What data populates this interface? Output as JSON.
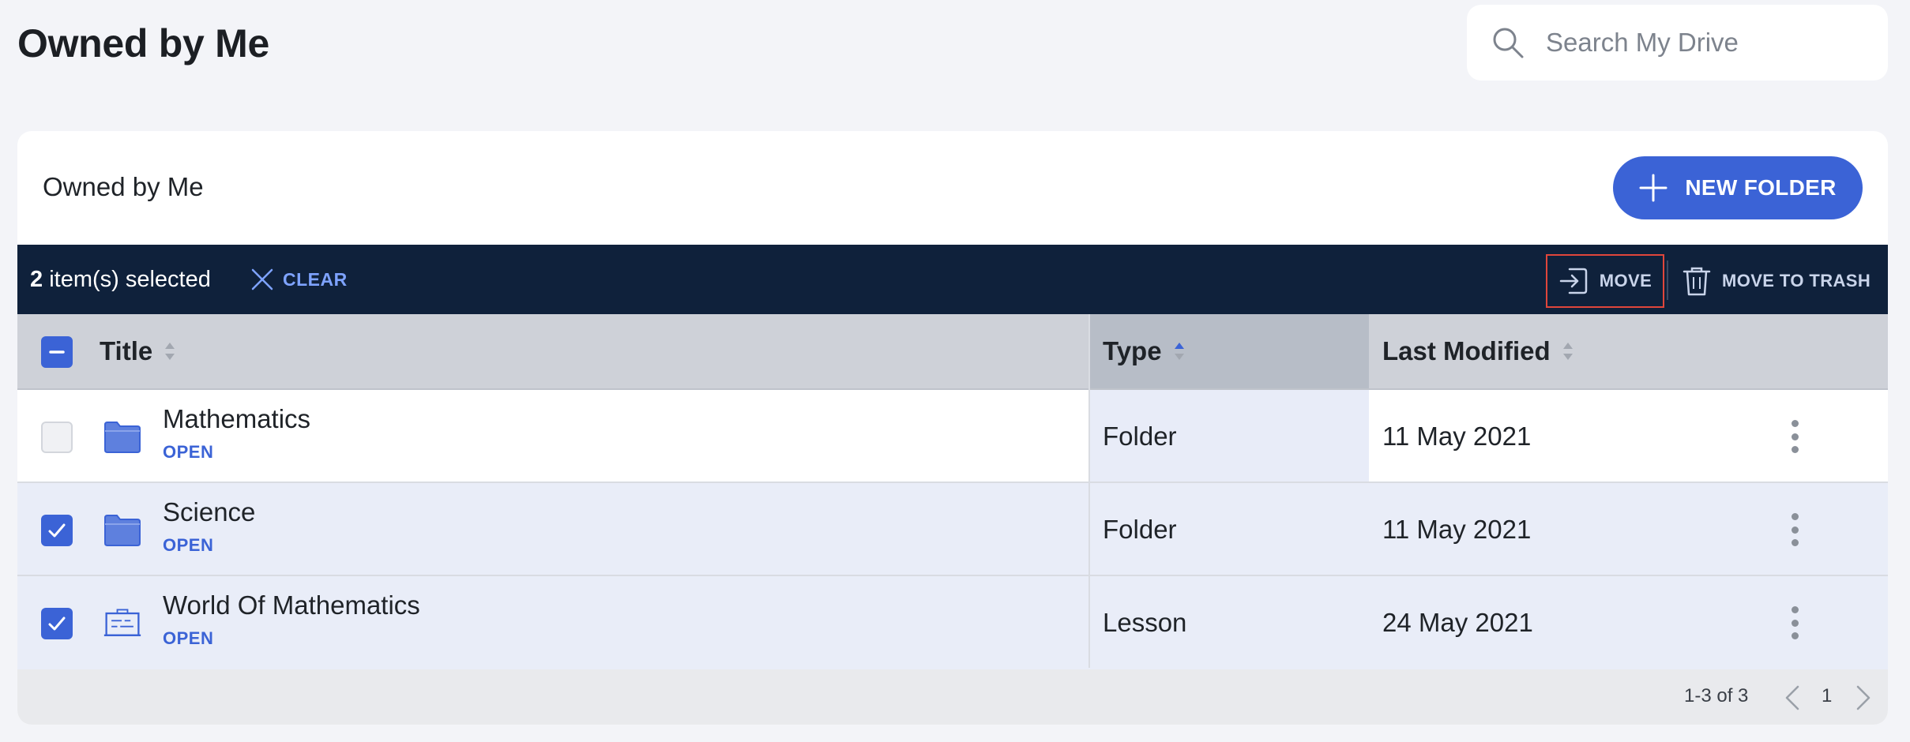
{
  "page": {
    "title": "Owned by Me"
  },
  "search": {
    "placeholder": "Search My Drive",
    "value": ""
  },
  "card": {
    "title": "Owned by Me",
    "new_folder_label": "NEW FOLDER"
  },
  "selection_bar": {
    "count": "2",
    "count_suffix": " item(s) selected",
    "clear_label": "CLEAR",
    "move_label": "MOVE",
    "trash_label": "MOVE TO TRASH"
  },
  "table": {
    "columns": [
      {
        "label": "Title",
        "sort": "none"
      },
      {
        "label": "Type",
        "sort": "ascending"
      },
      {
        "label": "Last Modified",
        "sort": "none"
      }
    ],
    "rows": [
      {
        "name": "Mathematics",
        "action": "OPEN",
        "type": "Folder",
        "modified": "11 May 2021",
        "selected": false,
        "icon": "folder-icon"
      },
      {
        "name": "Science",
        "action": "OPEN",
        "type": "Folder",
        "modified": "11 May 2021",
        "selected": true,
        "icon": "folder-icon"
      },
      {
        "name": "World Of Mathematics",
        "action": "OPEN",
        "type": "Lesson",
        "modified": "24 May 2021",
        "selected": true,
        "icon": "lesson-board-icon"
      }
    ]
  },
  "pagination": {
    "range": "1-3 of 3",
    "page": "1"
  },
  "colors": {
    "accent": "#3b63d6",
    "selection_bar": "#0f213b",
    "highlight_border": "#e0463b"
  }
}
